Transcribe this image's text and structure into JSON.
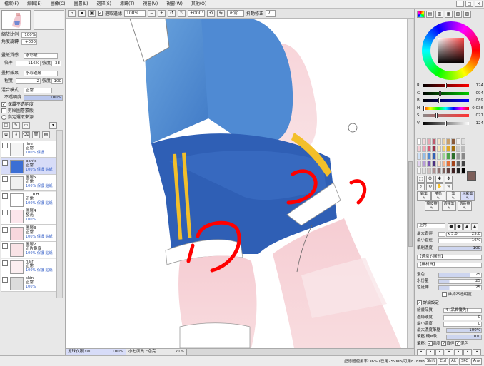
{
  "menu": [
    "檔案(F)",
    "編輯(E)",
    "圖像(C)",
    "圖層(L)",
    "選擇(S)",
    "濾鏡(T)",
    "視窗(V)",
    "視窗(W)",
    "其他(O)"
  ],
  "window_controls": [
    "_",
    "□",
    "×"
  ],
  "toolbar": {
    "select_label": "選取邊緣",
    "zoom": "100%",
    "rotate": "+000°",
    "mode": "正常",
    "stabilizer_label": "抖動修正",
    "stabilizer_value": "7"
  },
  "navigator": {
    "zoom_label": "縮放比例",
    "zoom_value": "100%",
    "angle_label": "角度旋轉",
    "angle_value": "+000"
  },
  "paper": {
    "texture_label": "畫紙質感",
    "texture_value": "水彩紙",
    "scale_label": "倍率",
    "scale_value": "116%",
    "strength_label": "強度",
    "strength_value": "38",
    "effect_label": "畫材效果",
    "effect_value": "水彩邊緣",
    "degree_label": "程度",
    "degree_value": "2",
    "degree_strength_label": "強度",
    "degree_strength_value": "100"
  },
  "blend": {
    "label": "混合模式",
    "value": "正常",
    "opacity_label": "不透明度",
    "opacity_value": "100%",
    "opt1": "保護不透明度",
    "opt2": "剪貼圖層蒙版",
    "opt3": "指定選取來源"
  },
  "layers": [
    {
      "name": "line",
      "mode": "正常",
      "opacity": "100% 保護",
      "thumb": "#f4f4f4"
    },
    {
      "name": "pants",
      "mode": "正常",
      "opacity": "100% 保護 貼紙",
      "thumb": "#3c6fd4",
      "sel": true
    },
    {
      "name": "圖層5",
      "mode": "正常",
      "opacity": "100% 保護 貼紙",
      "thumb": "#f0f0f0"
    },
    {
      "name": "CLOTH",
      "mode": "正常",
      "opacity": "100% 保護 貼紙",
      "thumb": "#ffffff"
    },
    {
      "name": "圖層4",
      "mode": "發光",
      "opacity": "100%",
      "thumb": "#fce6ec"
    },
    {
      "name": "圖層3",
      "mode": "正常",
      "opacity": "100% 保護 貼紙",
      "thumb": "#f7d7dd"
    },
    {
      "name": "圖層2",
      "mode": "正片疊底",
      "opacity": "100% 保護 貼紙",
      "thumb": "#f9e3e6"
    },
    {
      "name": "hair",
      "mode": "正常",
      "opacity": "100% 保護 貼紙",
      "thumb": "#fbeef0"
    },
    {
      "name": "skin",
      "mode": "正常",
      "opacity": "100%",
      "thumb": "#dcdcdc"
    }
  ],
  "sliders": [
    {
      "k": "R",
      "v": "124",
      "from": "#000",
      "to": "#f00",
      "pos": 0.49
    },
    {
      "k": "G",
      "v": "094",
      "from": "#000",
      "to": "#0c0",
      "pos": 0.37
    },
    {
      "k": "B",
      "v": "089",
      "from": "#000",
      "to": "#00f",
      "pos": 0.35
    },
    {
      "k": "H",
      "v": "0.036",
      "from": "#f00",
      "to": "#f0f",
      "pos": 0.02
    },
    {
      "k": "S",
      "v": "071",
      "from": "#888",
      "to": "#f33",
      "pos": 0.28
    },
    {
      "k": "V",
      "v": "124",
      "from": "#000",
      "to": "#fff",
      "pos": 0.49
    }
  ],
  "tools": [
    "鉛筆",
    "噴槍",
    "筆",
    "水彩筆",
    "橡皮擦",
    "選擇筆",
    "選區擦"
  ],
  "brush": {
    "mode": "正常",
    "max_size_label": "最大直徑",
    "max_size_mult": "x 5.0",
    "max_size_value": "25.0",
    "min_size_label": "最小直徑",
    "min_size_value": "16%",
    "density_label": "筆刷濃度",
    "density_value": "100",
    "shape_label": "【通常的圓形】",
    "texture_label": "【無材質】",
    "mix_label": "混色",
    "mix_value": "75",
    "water_label": "水份量",
    "water_value": "25",
    "stretch_label": "色延伸",
    "stretch_value": "25",
    "keep_opacity": "維持不透明度",
    "detail_label": "詳細設定",
    "quality_label": "繪畫品質",
    "quality_value": "4 (品質優先)",
    "edge_label": "邊緣硬度",
    "edge_value": "0",
    "min_dens_label": "最小濃度",
    "min_dens_value": "0",
    "max_pressure_label": "最大濃度筆壓",
    "max_pressure_value": "100%",
    "hard_soft_label": "筆壓 硬⇔軟",
    "hard_soft_value": "100",
    "pressure_label": "筆壓:",
    "p1": "濃度",
    "p2": "直徑",
    "p3": "混色"
  },
  "tabs": [
    {
      "name": "足球衣服.sai",
      "zoom": "100%",
      "active": true
    },
    {
      "name": "小七店員上色完...",
      "zoom": "71%",
      "active": false
    }
  ],
  "status": "記憶體使用率:36% (已用259MB/可用878MB)",
  "status_keys": [
    "Shift",
    "Ctrl",
    "Alt",
    "SPC",
    "Any"
  ],
  "colors": {
    "current": "#7c5e59",
    "accent": "#3c6fd4"
  }
}
